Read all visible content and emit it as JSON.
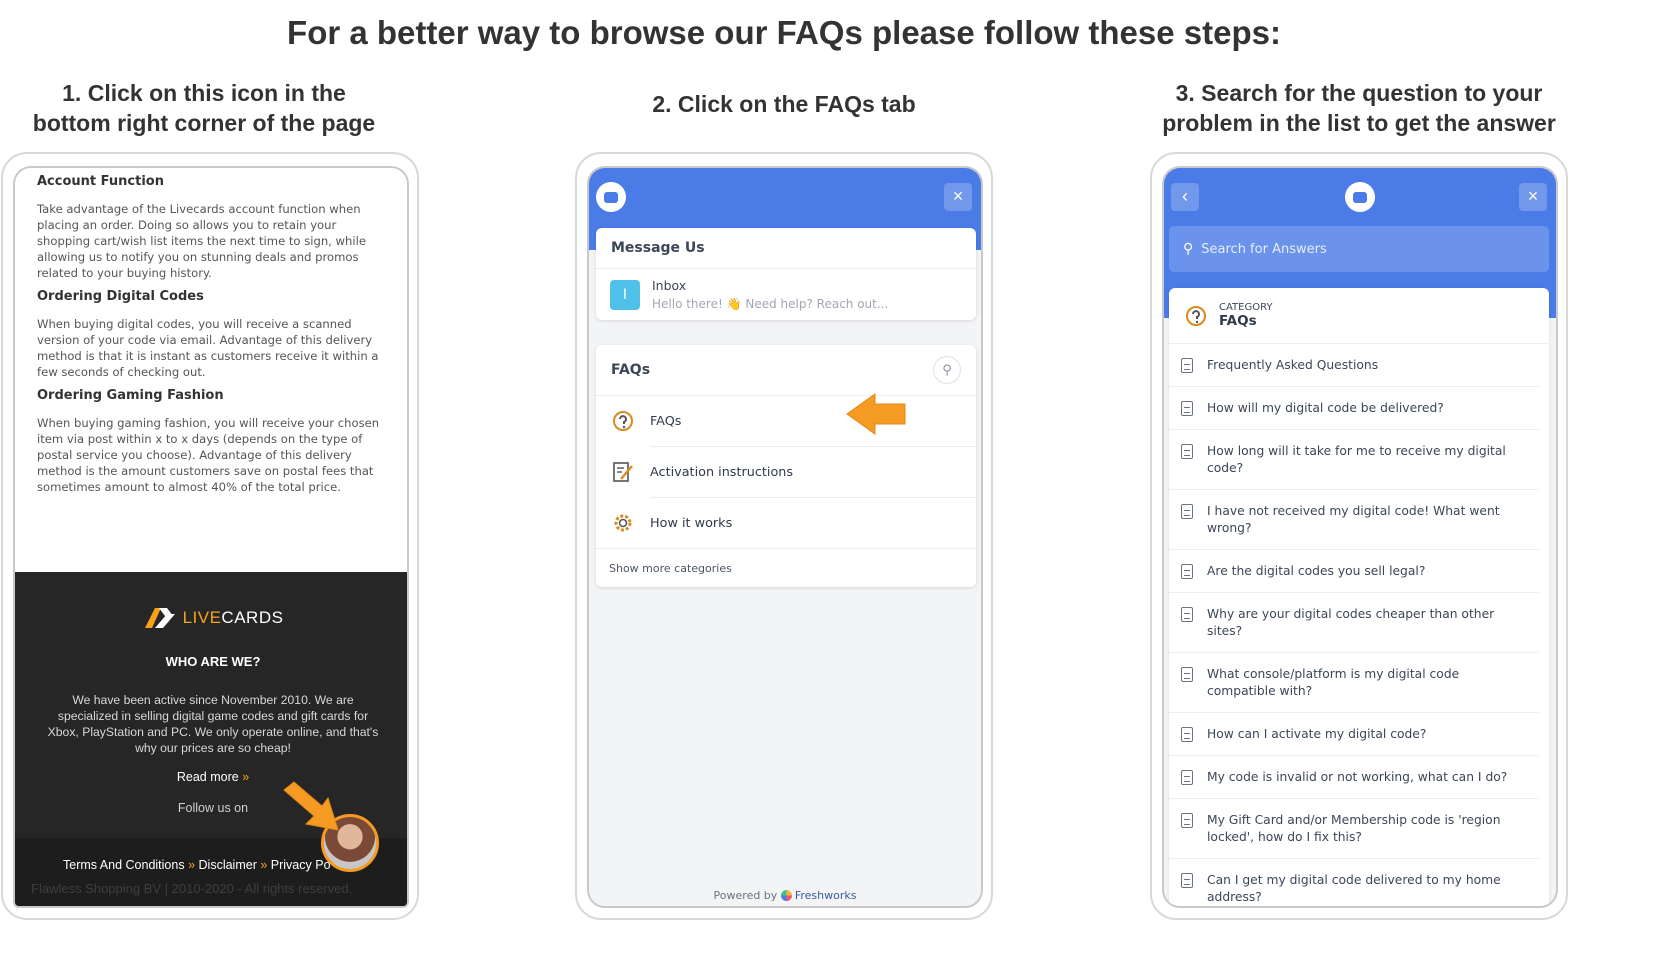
{
  "header": {
    "title": "For a better way to browse our FAQs please follow these steps:"
  },
  "steps": [
    {
      "title_line1": "1. Click on this icon in the",
      "title_line2": "bottom right corner of the page"
    },
    {
      "title_line1": "2. Click on the FAQs tab"
    },
    {
      "title_line1": "3. Search for the question to your",
      "title_line2": "problem in the list to get the answer"
    }
  ],
  "phone1": {
    "sections": [
      {
        "heading": "Account Function",
        "body": "Take advantage of the Livecards account function when placing an order. Doing so allows you to retain your shopping cart/wish list items the next time to sign, while allowing us to notify you on stunning deals and promos related to your buying history."
      },
      {
        "heading": "Ordering Digital Codes",
        "body": "When buying digital codes, you will receive a scanned version of your code via email. Advantage of this delivery method is that it is instant as customers receive it within a few seconds of checking out."
      },
      {
        "heading": "Ordering Gaming Fashion",
        "body": "When buying gaming fashion, you will receive your chosen item via post within x to x days (depends on the type of postal service you choose). Advantage of this delivery method is the amount customers save on postal fees that sometimes amount to almost 40% of the total price."
      }
    ],
    "footer": {
      "logo_live": "LIVE",
      "logo_cards": "CARDS",
      "who_title": "WHO ARE WE?",
      "about": "We have been active since November 2010. We are specialized in selling digital game codes and gift cards for Xbox, PlayStation and PC. We only operate online, and that's why our prices are so cheap!",
      "read_more": "Read more",
      "read_more_arrow": "»",
      "follow": "Follow us on",
      "link1": "Terms And Conditions",
      "link2": "Disclaimer",
      "link3": "Privacy Po",
      "sep": "»",
      "copyright": "Flawless Shopping BV | 2010-2020 - All rights reserved."
    }
  },
  "phone2": {
    "close_symbol": "×",
    "message_us": "Message Us",
    "inbox_letter": "I",
    "inbox_title": "Inbox",
    "inbox_preview": "Hello there! 👋 Need help? Reach out...",
    "faqs_title": "FAQs",
    "categories": [
      {
        "label": "FAQs",
        "icon": "faq-icon"
      },
      {
        "label": "Activation instructions",
        "icon": "activation-icon"
      },
      {
        "label": "How it works",
        "icon": "gear-icon"
      }
    ],
    "show_more": "Show more categories",
    "powered_by": "Powered by",
    "freshworks": "Freshworks"
  },
  "phone3": {
    "back_symbol": "‹",
    "close_symbol": "×",
    "search_placeholder": "Search for Answers",
    "category_label": "CATEGORY",
    "category_name": "FAQs",
    "questions": [
      "Frequently Asked Questions",
      "How will my digital code be delivered?",
      "How long will it take for me to receive my digital code?",
      "I have not received my digital code! What went wrong?",
      "Are the digital codes you sell legal?",
      "Why are your digital codes cheaper than other sites?",
      "What console/platform is my digital code compatible with?",
      "How can I activate my digital code?",
      "My code is invalid or not working, what can I do?",
      "My Gift Card and/or Membership code is 'region locked', how do I fix this?",
      "Can I get my digital code delivered to my home address?"
    ]
  },
  "colors": {
    "accent_blue": "#4a7be6",
    "arrow_orange": "#f59a23",
    "footer_dark": "#262626"
  }
}
